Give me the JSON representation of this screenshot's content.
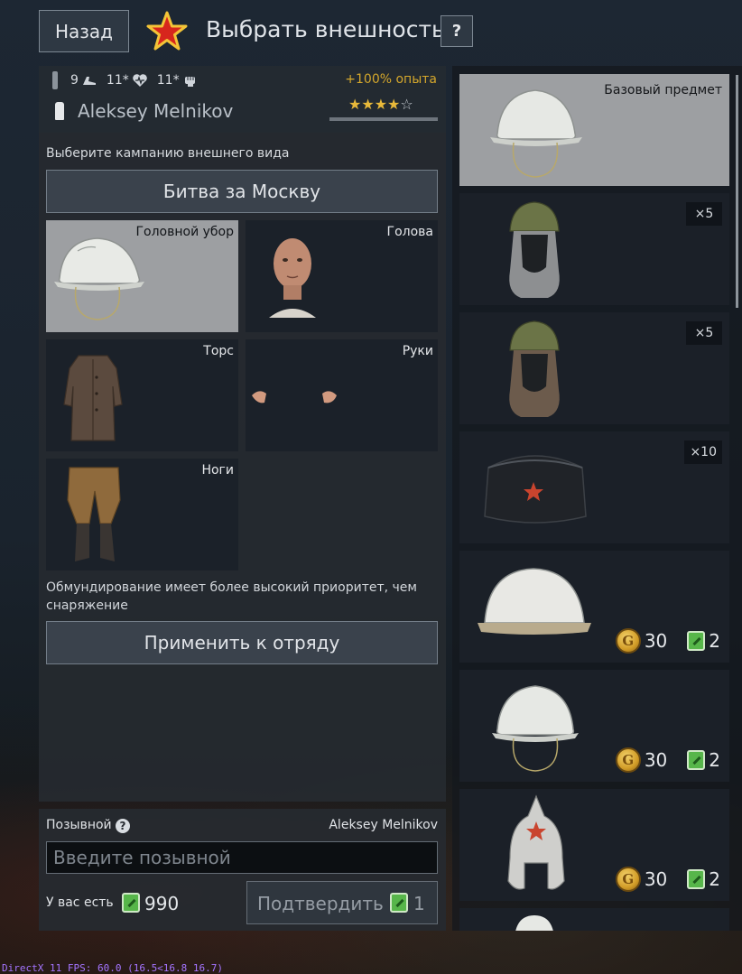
{
  "header": {
    "back_label": "Назад",
    "title": "Выбрать внешность",
    "help_label": "?"
  },
  "soldier": {
    "stats": [
      {
        "icon": "boot-icon",
        "value": "9"
      },
      {
        "icon": "health-icon",
        "value": "11*"
      },
      {
        "icon": "fist-icon",
        "value": "11*"
      }
    ],
    "exp_bonus": "+100% опыта",
    "name": "Aleksey Melnikov",
    "rating": {
      "filled": 4,
      "total": 5
    },
    "level_progress": 1.0
  },
  "campaign": {
    "label": "Выберите кампанию внешнего вида",
    "selected": "Битва за Москву"
  },
  "slots": [
    {
      "id": "headgear",
      "label": "Головной убор",
      "selected": true
    },
    {
      "id": "head",
      "label": "Голова",
      "selected": false
    },
    {
      "id": "torso",
      "label": "Торс",
      "selected": false
    },
    {
      "id": "hands",
      "label": "Руки",
      "selected": false
    },
    {
      "id": "legs",
      "label": "Ноги",
      "selected": false
    }
  ],
  "priority_note": "Обмундирование имеет более высокий приоритет, чем снаряжение",
  "apply_label": "Применить к отряду",
  "callsign": {
    "label": "Позывной",
    "current": "Aleksey Melnikov",
    "placeholder": "Введите позывной",
    "balance_label": "У вас есть",
    "balance": "990",
    "confirm_label": "Подтвердить",
    "confirm_cost": "1"
  },
  "items": [
    {
      "kind": "white-helmet",
      "base_label": "Базовый предмет"
    },
    {
      "kind": "green-helmet-hood",
      "qty": "×5"
    },
    {
      "kind": "green-helmet-hood",
      "qty": "×5"
    },
    {
      "kind": "ushanka",
      "qty": "×10"
    },
    {
      "kind": "white-helmet-wide",
      "gold": "30",
      "tickets": "2"
    },
    {
      "kind": "white-helmet",
      "gold": "30",
      "tickets": "2"
    },
    {
      "kind": "budenovka",
      "gold": "30",
      "tickets": "2"
    }
  ],
  "gold_symbol": "G",
  "fps_text": "DirectX 11 FPS: 60.0 (16.5<16.8 16.7)",
  "colors": {
    "accent_gold": "#d4a72c",
    "star_red": "#d7261d",
    "ticket_green": "#57b64a"
  }
}
